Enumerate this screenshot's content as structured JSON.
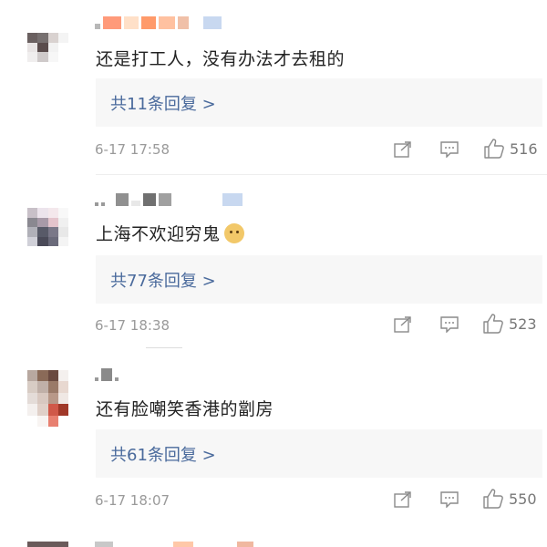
{
  "comments": [
    {
      "text": "还是打工人，没有办法才去租的",
      "reply_label": "共11条回复 >",
      "timestamp": "6-17 17:58",
      "like_count": "516"
    },
    {
      "text": "上海不欢迎穷鬼",
      "reply_label": "共77条回复 >",
      "timestamp": "6-17 18:38",
      "like_count": "523"
    },
    {
      "text": "还有脸嘲笑香港的劏房",
      "reply_label": "共61条回复 >",
      "timestamp": "6-17 18:07",
      "like_count": "550"
    }
  ],
  "icons": {
    "share": "share-icon",
    "comment": "comment-icon",
    "like": "thumbs-up-icon",
    "emoji": "doge-emoji-icon"
  },
  "colors": {
    "reply_link": "#4a6a9c",
    "text": "#222222",
    "muted": "#9a9a9a",
    "reply_bg": "#f7f7f7"
  }
}
